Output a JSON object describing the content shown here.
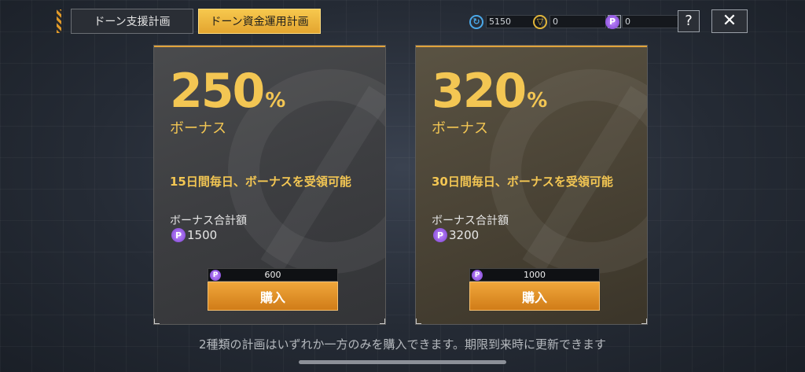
{
  "tabs": [
    {
      "label": "ドーン支援計画",
      "active": false
    },
    {
      "label": "ドーン資金運用計画",
      "active": true
    }
  ],
  "resources": [
    {
      "icon": "blue-coin-icon",
      "value": "5150"
    },
    {
      "icon": "gold-coin-icon",
      "value": "0"
    },
    {
      "icon": "purple-p-coin-icon",
      "value": "0"
    }
  ],
  "header": {
    "help_label": "?",
    "close_label": "✕",
    "plus_label": "+"
  },
  "plans": [
    {
      "percent": "250",
      "percent_sign": "%",
      "bonus_label": "ボーナス",
      "description": "15日間毎日、ボーナスを受領可能",
      "total_label": "ボーナス合計額",
      "total_value": "1500",
      "price": "600",
      "buy_label": "購入"
    },
    {
      "percent": "320",
      "percent_sign": "%",
      "bonus_label": "ボーナス",
      "description": "30日間毎日、ボーナスを受領可能",
      "total_label": "ボーナス合計額",
      "total_value": "3200",
      "price": "1000",
      "buy_label": "購入"
    }
  ],
  "notice": "2種類の計画はいずれか一方のみを購入できます。期限到来時に更新できます",
  "colors": {
    "accent": "#f3c653",
    "button": "#e3952c",
    "coin_purple": "#9b5ce8"
  }
}
